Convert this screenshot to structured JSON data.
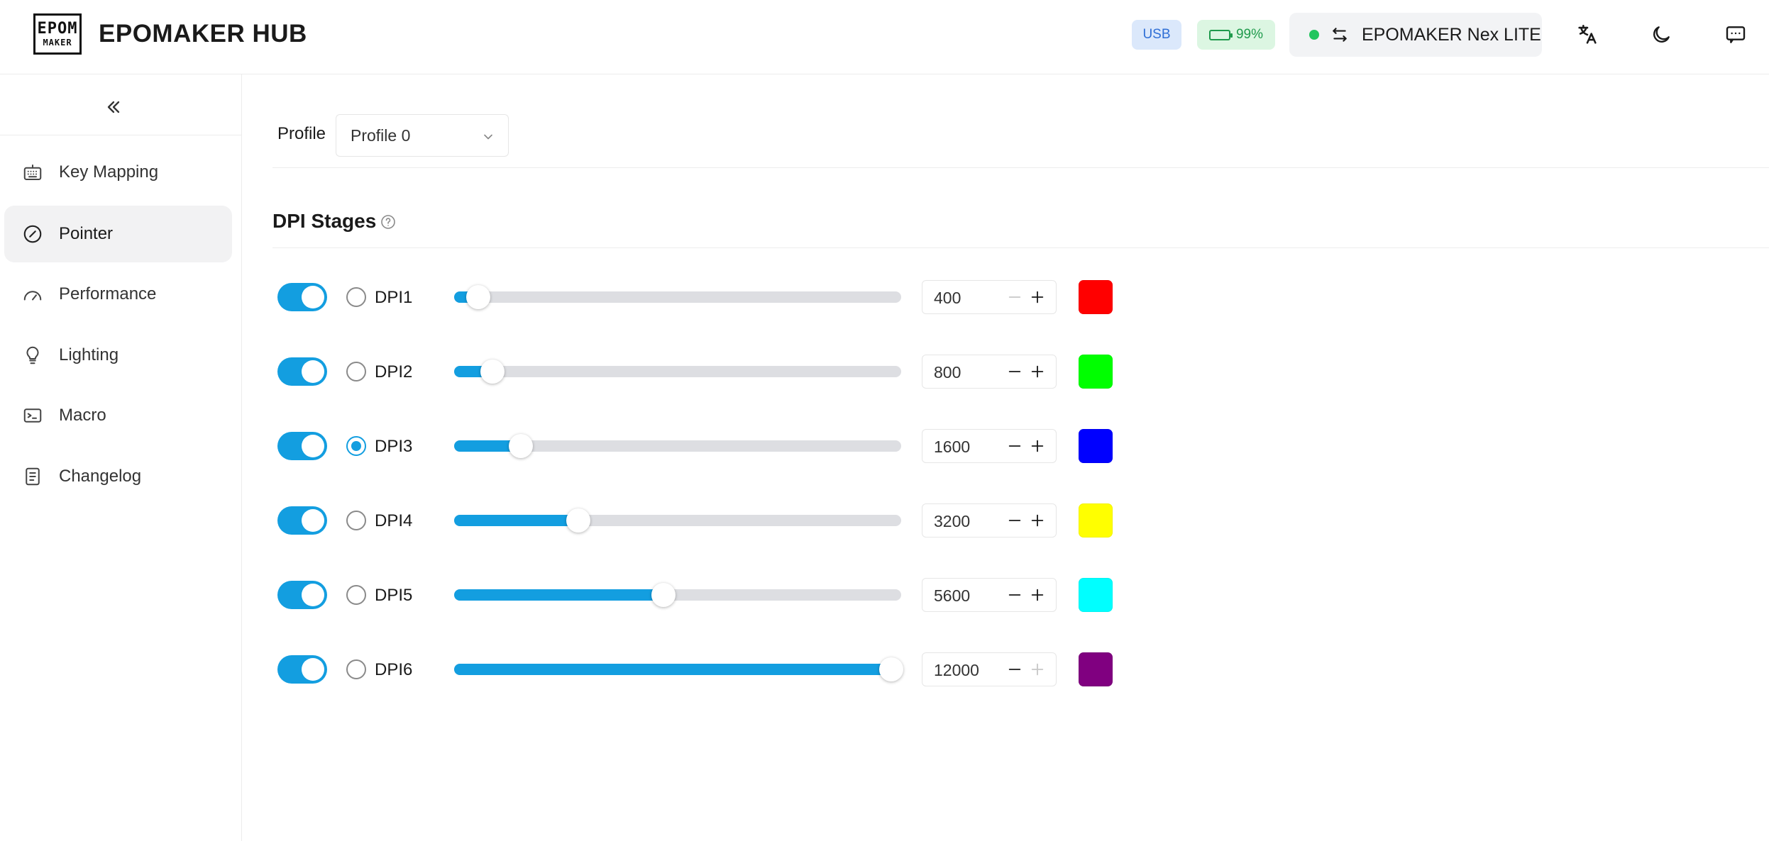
{
  "app": {
    "logo_line1": "EPOM",
    "logo_line2": "MAKER",
    "title": "EPOMAKER HUB"
  },
  "header": {
    "connection_badge": "USB",
    "battery_text": "99%",
    "battery_level_percent": 99,
    "device_name": "EPOMAKER Nex LITE",
    "device_status_color": "#22c55e",
    "icons": [
      "translate-icon",
      "moon-icon",
      "chat-icon"
    ]
  },
  "sidebar": {
    "items": [
      {
        "label": "Key Mapping",
        "icon": "keyboard-icon",
        "active": false
      },
      {
        "label": "Pointer",
        "icon": "pointer-icon",
        "active": true
      },
      {
        "label": "Performance",
        "icon": "gauge-icon",
        "active": false
      },
      {
        "label": "Lighting",
        "icon": "bulb-icon",
        "active": false
      },
      {
        "label": "Macro",
        "icon": "terminal-icon",
        "active": false
      },
      {
        "label": "Changelog",
        "icon": "document-icon",
        "active": false
      }
    ]
  },
  "profile": {
    "label": "Profile",
    "selected": "Profile 0"
  },
  "dpi": {
    "section_title": "DPI Stages",
    "slider_max": 12000,
    "stages": [
      {
        "label": "DPI1",
        "value": "400",
        "enabled": true,
        "selected": false,
        "color": "#ff0000",
        "minus_disabled": true,
        "plus_disabled": false
      },
      {
        "label": "DPI2",
        "value": "800",
        "enabled": true,
        "selected": false,
        "color": "#00ff00",
        "minus_disabled": false,
        "plus_disabled": false
      },
      {
        "label": "DPI3",
        "value": "1600",
        "enabled": true,
        "selected": true,
        "color": "#0000ff",
        "minus_disabled": false,
        "plus_disabled": false
      },
      {
        "label": "DPI4",
        "value": "3200",
        "enabled": true,
        "selected": false,
        "color": "#ffff00",
        "minus_disabled": false,
        "plus_disabled": false
      },
      {
        "label": "DPI5",
        "value": "5600",
        "enabled": true,
        "selected": false,
        "color": "#00ffff",
        "minus_disabled": false,
        "plus_disabled": false
      },
      {
        "label": "DPI6",
        "value": "12000",
        "enabled": true,
        "selected": false,
        "color": "#800080",
        "minus_disabled": false,
        "plus_disabled": true
      }
    ]
  },
  "theme": {
    "accent": "#139ee0"
  }
}
